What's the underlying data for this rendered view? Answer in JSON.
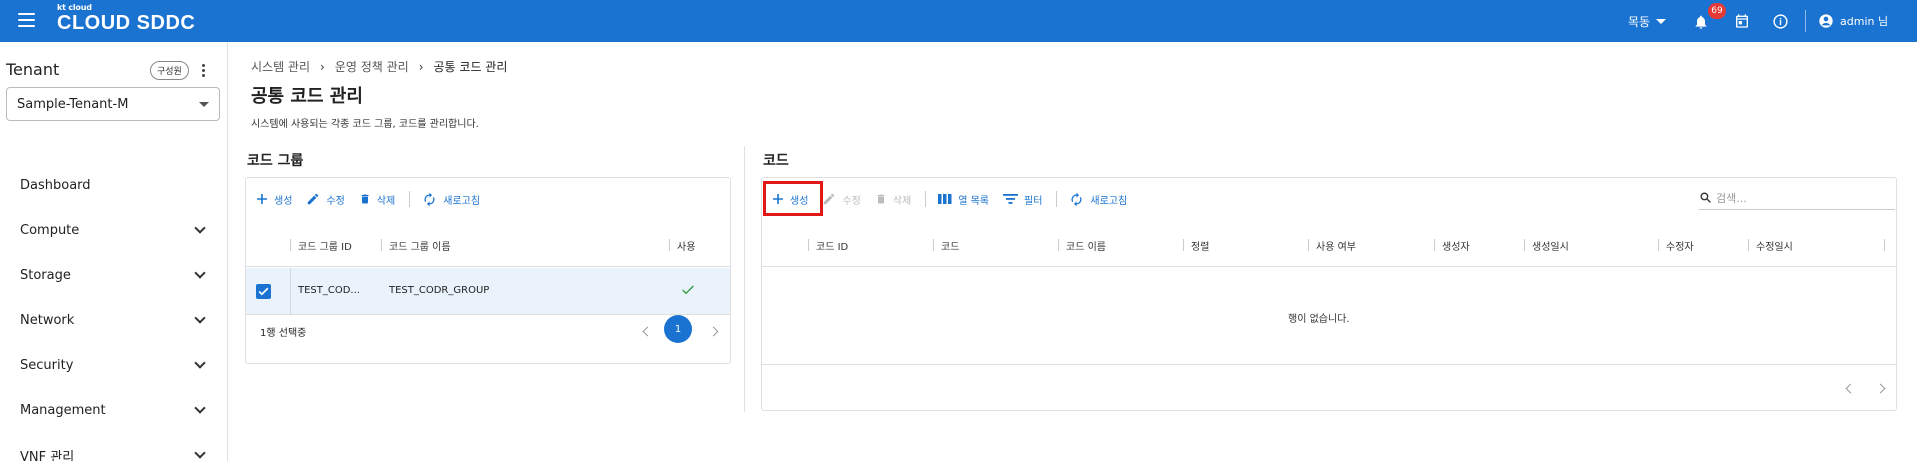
{
  "app": {
    "logo_small": "kt cloud",
    "logo_name": "CLOUD SDDC",
    "region": "목동",
    "notification_count": "69",
    "user": "admin 님"
  },
  "sidebar": {
    "tenant_label": "Tenant",
    "role_chip": "구성원",
    "tenant_value": "Sample-Tenant-M",
    "items": [
      {
        "label": "Dashboard"
      },
      {
        "label": "Compute"
      },
      {
        "label": "Storage"
      },
      {
        "label": "Network"
      },
      {
        "label": "Security"
      },
      {
        "label": "Management"
      },
      {
        "label": "VNF 관리"
      }
    ]
  },
  "breadcrumb": [
    "시스템 관리",
    "운영 정책 관리",
    "공통 코드 관리"
  ],
  "page": {
    "title": "공통 코드 관리",
    "description": "시스템에 사용되는 각종 코드 그룹, 코드를 관리합니다."
  },
  "code_group": {
    "title": "코드 그룹",
    "toolbar": {
      "create": "생성",
      "edit": "수정",
      "delete": "삭제",
      "refresh": "새로고침"
    },
    "columns": [
      "코드 그룹 ID",
      "코드 그룹 이름",
      "사용"
    ],
    "rows": [
      {
        "id": "TEST_COD...",
        "name": "TEST_CODR_GROUP",
        "used": true
      }
    ],
    "selection_text": "1행 선택중",
    "page": "1"
  },
  "code": {
    "title": "코드",
    "toolbar": {
      "create": "생성",
      "edit": "수정",
      "delete": "삭제",
      "columns": "열 목록",
      "filter": "필터",
      "refresh": "새로고침"
    },
    "search_placeholder": "검색...",
    "columns": [
      "코드 ID",
      "코드",
      "코드 이름",
      "정렬",
      "사용 여부",
      "생성자",
      "생성일시",
      "수정자",
      "수정일시"
    ],
    "empty_text": "행이 없습니다."
  },
  "colors": {
    "primary": "#1a73d1",
    "highlight": "#e21818",
    "selected_row": "#eaf3fc"
  }
}
